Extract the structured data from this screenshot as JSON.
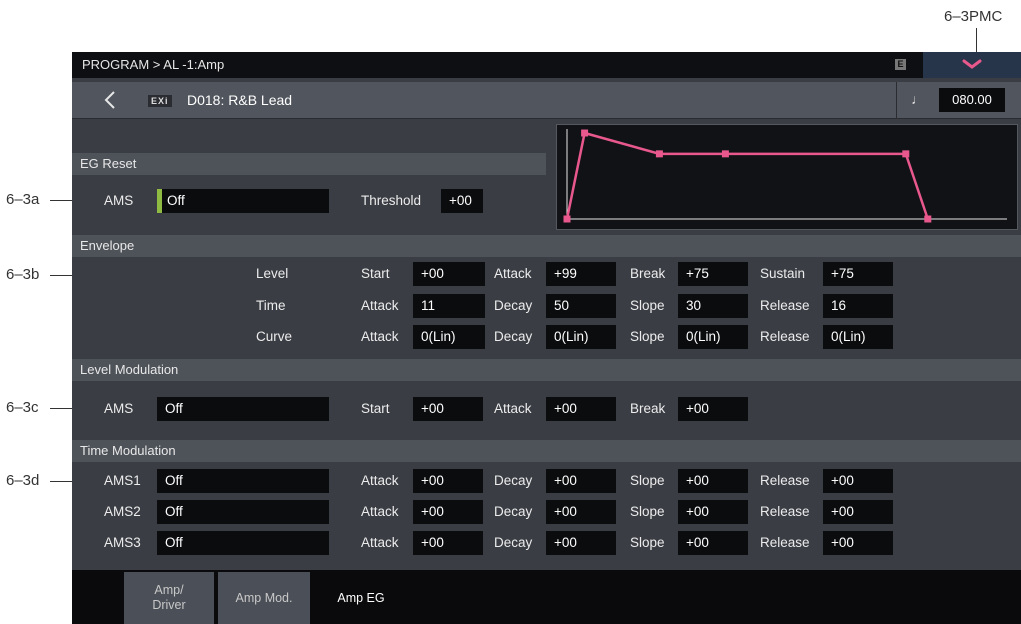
{
  "callouts": {
    "pmc": "6–3PMC",
    "a": "6–3a",
    "b": "6–3b",
    "c": "6–3c",
    "d": "6–3d"
  },
  "titlebar": {
    "breadcrumb": "PROGRAM > AL -1:Amp",
    "badge": "E"
  },
  "program": {
    "exi_tag": "EXi",
    "name": "D018: R&B Lead",
    "tempo_icon": "♩",
    "tempo": "080.00"
  },
  "eg_reset": {
    "title": "EG Reset",
    "ams_label": "AMS",
    "ams_value": "Off",
    "threshold_label": "Threshold",
    "threshold_value": "+00"
  },
  "eg_graph": {
    "points": [
      {
        "t": 0,
        "level": 0
      },
      {
        "t": 0.04,
        "level": 99
      },
      {
        "t": 0.21,
        "level": 75
      },
      {
        "t": 0.36,
        "level": 75
      },
      {
        "t": 0.77,
        "level": 75
      },
      {
        "t": 0.82,
        "level": 0
      }
    ],
    "line_color": "#e8588c",
    "axis_color": "#e6e6e6"
  },
  "envelope": {
    "title": "Envelope",
    "rows": [
      {
        "label": "Level",
        "params": [
          {
            "name": "Start",
            "value": "+00"
          },
          {
            "name": "Attack",
            "value": "+99"
          },
          {
            "name": "Break",
            "value": "+75"
          },
          {
            "name": "Sustain",
            "value": "+75"
          }
        ]
      },
      {
        "label": "Time",
        "params": [
          {
            "name": "Attack",
            "value": "11"
          },
          {
            "name": "Decay",
            "value": "50"
          },
          {
            "name": "Slope",
            "value": "30"
          },
          {
            "name": "Release",
            "value": "16"
          }
        ]
      },
      {
        "label": "Curve",
        "params": [
          {
            "name": "Attack",
            "value": "0(Lin)"
          },
          {
            "name": "Decay",
            "value": "0(Lin)"
          },
          {
            "name": "Slope",
            "value": "0(Lin)"
          },
          {
            "name": "Release",
            "value": "0(Lin)"
          }
        ]
      }
    ]
  },
  "level_mod": {
    "title": "Level Modulation",
    "ams_label": "AMS",
    "ams_value": "Off",
    "params": [
      {
        "name": "Start",
        "value": "+00"
      },
      {
        "name": "Attack",
        "value": "+00"
      },
      {
        "name": "Break",
        "value": "+00"
      }
    ]
  },
  "time_mod": {
    "title": "Time Modulation",
    "rows": [
      {
        "label": "AMS1",
        "ams": "Off",
        "params": [
          {
            "name": "Attack",
            "value": "+00"
          },
          {
            "name": "Decay",
            "value": "+00"
          },
          {
            "name": "Slope",
            "value": "+00"
          },
          {
            "name": "Release",
            "value": "+00"
          }
        ]
      },
      {
        "label": "AMS2",
        "ams": "Off",
        "params": [
          {
            "name": "Attack",
            "value": "+00"
          },
          {
            "name": "Decay",
            "value": "+00"
          },
          {
            "name": "Slope",
            "value": "+00"
          },
          {
            "name": "Release",
            "value": "+00"
          }
        ]
      },
      {
        "label": "AMS3",
        "ams": "Off",
        "params": [
          {
            "name": "Attack",
            "value": "+00"
          },
          {
            "name": "Decay",
            "value": "+00"
          },
          {
            "name": "Slope",
            "value": "+00"
          },
          {
            "name": "Release",
            "value": "+00"
          }
        ]
      }
    ]
  },
  "tabs": [
    {
      "label_line1": "Amp/",
      "label_line2": "Driver",
      "active": false
    },
    {
      "label_line1": "Amp Mod.",
      "label_line2": "",
      "active": false
    },
    {
      "label_line1": "Amp EG",
      "label_line2": "",
      "active": true
    }
  ]
}
